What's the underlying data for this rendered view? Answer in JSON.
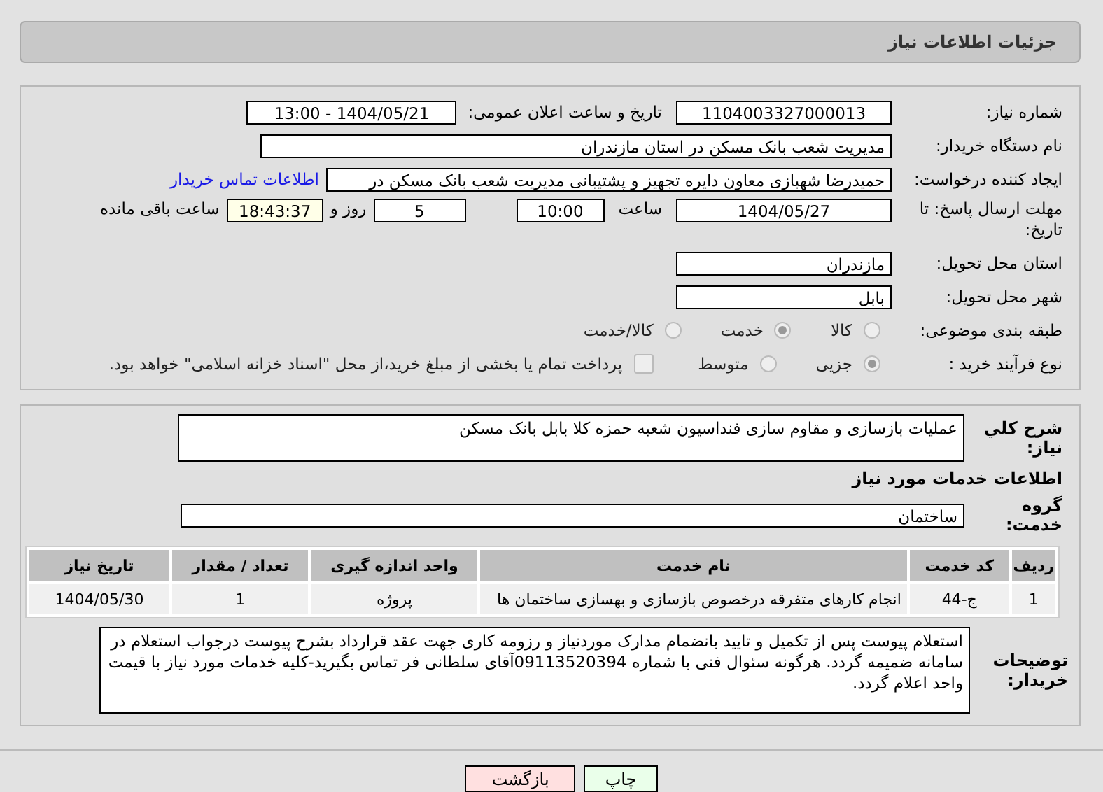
{
  "header": {
    "title": "جزئیات اطلاعات نیاز"
  },
  "need_number": {
    "label": "شماره نیاز:",
    "value": "1104003327000013"
  },
  "announce": {
    "label": "تاریخ و ساعت اعلان عمومی:",
    "value": "1404/05/21 - 13:00"
  },
  "buyer": {
    "label": "نام دستگاه خریدار:",
    "value": "مدیریت شعب بانک مسکن در استان مازندران"
  },
  "creator": {
    "label": "ایجاد کننده درخواست:",
    "value": "حمیدرضا شهبازی معاون دایره تجهیز و پشتیبانی  مدیریت شعب بانک مسکن در",
    "link": "اطلاعات تماس خریدار"
  },
  "deadline": {
    "label": "مهلت ارسال پاسخ: تا تاریخ:",
    "date": "1404/05/27",
    "time_label": "ساعت",
    "time": "10:00",
    "days": "5",
    "days_label": "روز و",
    "remaining": "18:43:37",
    "remaining_label": "ساعت باقی مانده"
  },
  "province": {
    "label": "استان محل تحویل:",
    "value": "مازندران"
  },
  "city": {
    "label": "شهر محل تحویل:",
    "value": "بابل"
  },
  "category": {
    "label": "طبقه بندی موضوعی:",
    "options": [
      {
        "label": "کالا",
        "selected": false
      },
      {
        "label": "خدمت",
        "selected": true
      },
      {
        "label": "کالا/خدمت",
        "selected": false
      }
    ]
  },
  "process": {
    "label": "نوع فرآیند خرید :",
    "options": [
      {
        "label": "جزیی",
        "selected": true
      },
      {
        "label": "متوسط",
        "selected": false
      }
    ],
    "payment": {
      "label": "پرداخت تمام یا بخشی از مبلغ خرید،از محل \"اسناد خزانه اسلامی\" خواهد بود.",
      "checked": false
    }
  },
  "description": {
    "label": "شرح کلي نياز:",
    "value": "عملیات بازسازی و مقاوم سازی فنداسیون شعبه حمزه کلا بابل بانک مسکن"
  },
  "services_title": "اطلاعات خدمات مورد نیاز",
  "service_group": {
    "label": "گروه خدمت:",
    "value": "ساختمان"
  },
  "table": {
    "columns": [
      "ردیف",
      "کد خدمت",
      "نام خدمت",
      "واحد اندازه گیری",
      "تعداد / مقدار",
      "تاریخ نیاز"
    ],
    "rows": [
      [
        "1",
        "ج-44",
        "انجام کارهای متفرقه درخصوص بازسازی و بهسازی ساختمان ها",
        "پروژه",
        "1",
        "1404/05/30"
      ]
    ]
  },
  "notes": {
    "label": "توضیحات خریدار:",
    "value": "استعلام پیوست پس از تکمیل و تایید بانضمام مدارک موردنیاز و رزومه کاری جهت عقد قرارداد بشرح پیوست درجواب استعلام در سامانه ضمیمه گردد. هرگونه سئوال فنی با شماره 09113520394آقای سلطانی فر تماس بگیرید-کلیه خدمات مورد نیاز با قیمت واحد اعلام گردد."
  },
  "buttons": [
    {
      "label": "چاپ",
      "kind": "print"
    },
    {
      "label": "بازگشت",
      "kind": "back"
    }
  ]
}
